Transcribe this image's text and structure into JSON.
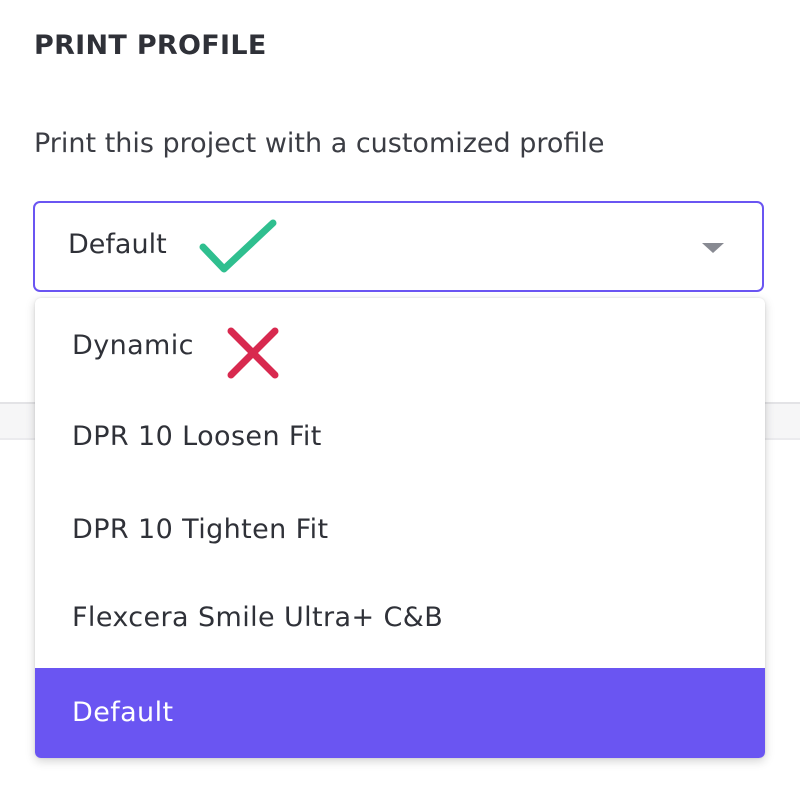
{
  "section": {
    "title": "PRINT PROFILE",
    "description": "Print this project with a customized profile"
  },
  "select": {
    "value": "Default",
    "value_marker_icon": "check-icon",
    "caret_icon": "caret-down-icon",
    "accent_color": "#6a55f2"
  },
  "dropdown": {
    "options": [
      {
        "label": "Dynamic",
        "marker_icon": "cross-icon"
      },
      {
        "label": "DPR 10  Loosen Fit"
      },
      {
        "label": "DPR 10  Tighten Fit"
      },
      {
        "label": "Flexcera Smile Ultra+ C&B"
      },
      {
        "label": "Default",
        "selected": true
      }
    ],
    "selected_bg_color": "#6a55f2",
    "check_color": "#2fbf8f",
    "cross_color": "#d8294f"
  }
}
